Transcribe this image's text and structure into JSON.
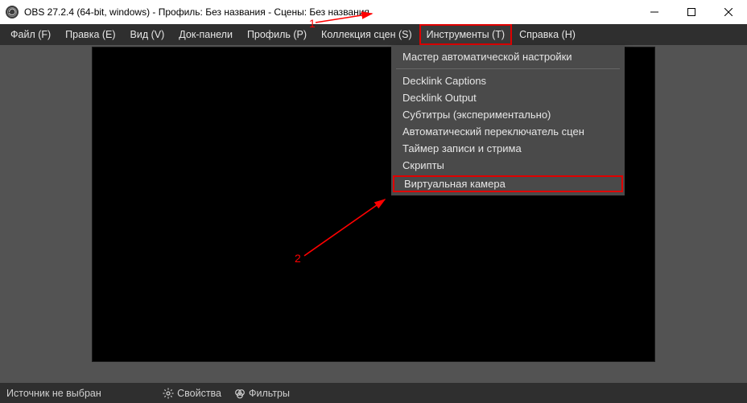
{
  "title": "OBS 27.2.4 (64-bit, windows) - Профиль: Без названия - Сцены: Без названия",
  "menu": {
    "file": "Файл (F)",
    "edit": "Правка (E)",
    "view": "Вид (V)",
    "dock": "Док-панели",
    "profile": "Профиль (P)",
    "scenes": "Коллекция сцен (S)",
    "tools": "Инструменты (T)",
    "help": "Справка (H)"
  },
  "tools_menu": {
    "autoconfig": "Мастер автоматической настройки",
    "decklink_captions": "Decklink Captions",
    "decklink_output": "Decklink Output",
    "subtitles": "Субтитры (экспериментально)",
    "auto_scene_switch": "Автоматический переключатель сцен",
    "timer": "Таймер записи и стрима",
    "scripts": "Скрипты",
    "virtual_camera": "Виртуальная камера"
  },
  "status": {
    "source_none": "Источник не выбран",
    "properties": "Свойства",
    "filters": "Фильтры"
  },
  "annotations": {
    "step1": "1",
    "step2": "2"
  }
}
